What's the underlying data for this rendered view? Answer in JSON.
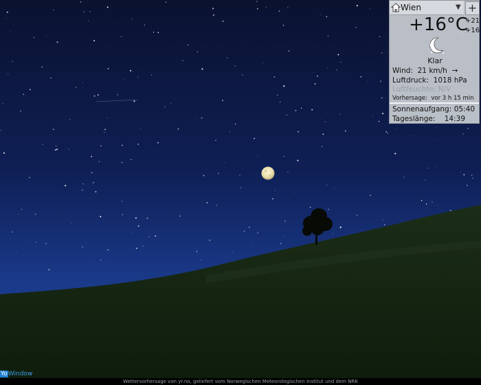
{
  "widget": {
    "city": "Wien",
    "temperature": "+16°C",
    "temp_high": "+21",
    "temp_low": "+16",
    "condition": "Klar",
    "wind_label": "Wind:",
    "wind_value": "21 km/h",
    "wind_arrow": "→",
    "pressure_label": "Luftdruck:",
    "pressure_value": "1018 hPa",
    "humidity_label": "Luftfeuchte:",
    "humidity_value": "N/V",
    "forecast_label": "Vorhersage:",
    "forecast_value": "vor 3 h 15 min",
    "sunrise_label": "Sonnenaufgang:",
    "sunrise_value": "05:40",
    "daylength_label": "Tageslänge:",
    "daylength_value": "14:39",
    "icons": [
      "home-icon",
      "dropdown-icon",
      "add-location-icon",
      "crescent-moon-icon"
    ]
  },
  "brand": {
    "part1": "Yo",
    "part2": "Window"
  },
  "credit": "Wettervorhersage von yr.no, geliefert vom Norwegischen Meteorologischen Institut und dem NRK",
  "colors": {
    "sky_top": "#0a1230",
    "sky_bottom": "#1a3a8a",
    "hill": "#162812",
    "widget_bg": "#c8ccd2"
  }
}
